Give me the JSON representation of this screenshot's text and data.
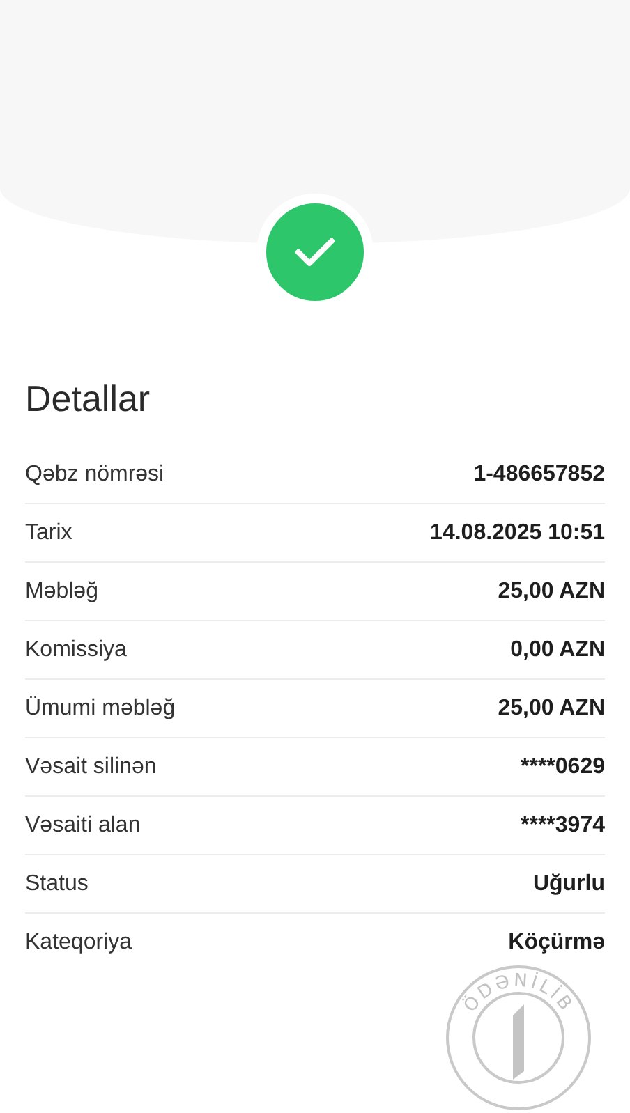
{
  "status_icon": {
    "kind": "success"
  },
  "section_title": "Detallar",
  "details": [
    {
      "label": "Qəbz nömrəsi",
      "value": "1-486657852"
    },
    {
      "label": "Tarix",
      "value": "14.08.2025 10:51"
    },
    {
      "label": "Məbləğ",
      "value": "25,00 AZN"
    },
    {
      "label": "Komissiya",
      "value": "0,00 AZN"
    },
    {
      "label": "Ümumi məbləğ",
      "value": "25,00 AZN"
    },
    {
      "label": "Vəsait silinən",
      "value": "****0629"
    },
    {
      "label": "Vəsaiti alan",
      "value": "****3974"
    },
    {
      "label": "Status",
      "value": "Uğurlu"
    },
    {
      "label": "Kateqoriya",
      "value": "Köçürmə"
    }
  ],
  "stamp": {
    "text": "ÖDƏNİLİB"
  }
}
